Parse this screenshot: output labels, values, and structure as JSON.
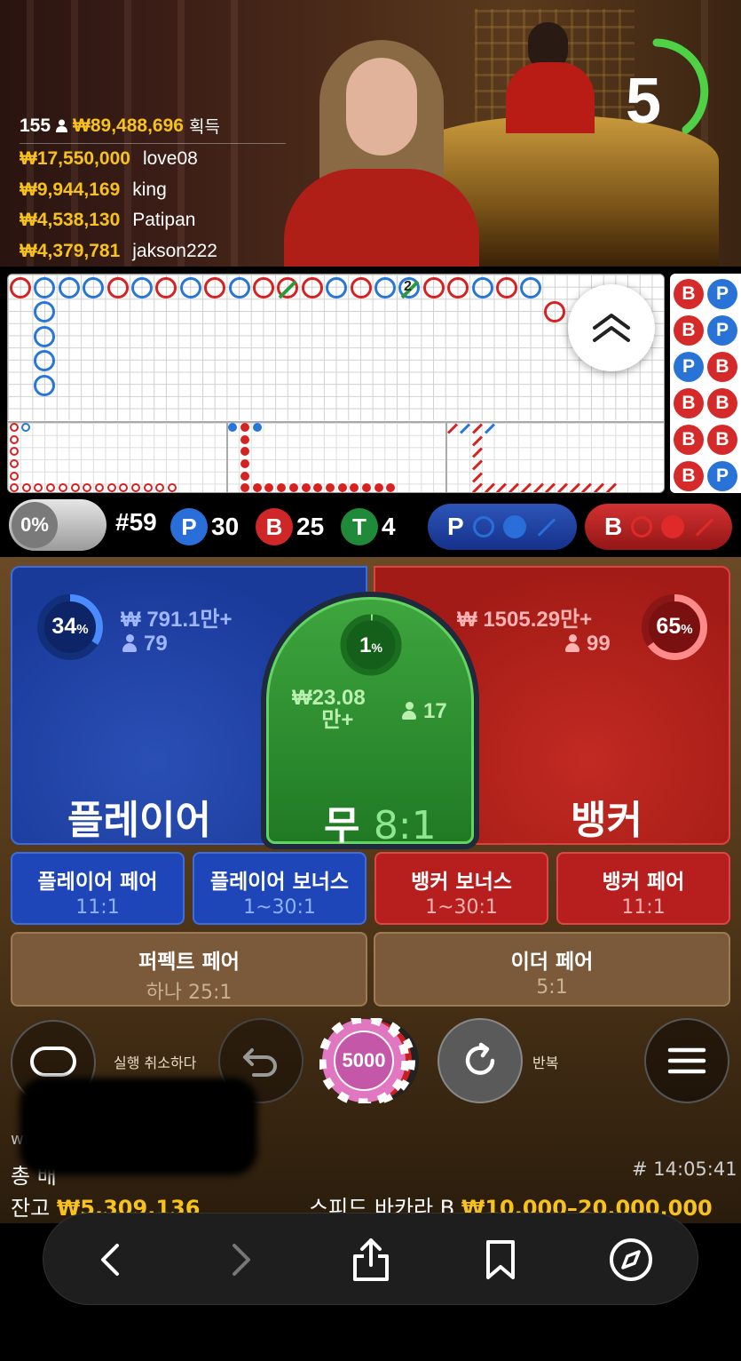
{
  "video": {
    "timer": "5",
    "winners_header": {
      "count": "155",
      "total": "₩89,488,696",
      "suffix": "획득"
    },
    "winners": [
      {
        "amount": "₩17,550,000",
        "name": "love08"
      },
      {
        "amount": "₩9,944,169",
        "name": "king"
      },
      {
        "amount": "₩4,538,130",
        "name": "Patipan"
      },
      {
        "amount": "₩4,379,781",
        "name": "jakson222"
      }
    ]
  },
  "roadmap": {
    "tie_marks": [
      "",
      "2"
    ]
  },
  "bead_column": [
    "B",
    "B",
    "P",
    "B",
    "B",
    "B",
    "P",
    "P",
    "B",
    "B",
    "B",
    "P"
  ],
  "stats": {
    "toggle_pct": "0%",
    "round": "#59",
    "player_label": "P",
    "player_count": "30",
    "banker_label": "B",
    "banker_count": "25",
    "tie_label": "T",
    "tie_count": "4",
    "predict_player": "P",
    "predict_banker": "B"
  },
  "bets": {
    "player": {
      "title": "플레이어",
      "pct": "34",
      "pct_sign": "%",
      "amount": "₩ 791.1만+",
      "users": "79"
    },
    "banker": {
      "title": "뱅커",
      "pct": "65",
      "pct_sign": "%",
      "amount": "₩ 1505.29만+",
      "users": "99"
    },
    "tie": {
      "title": "무",
      "odds": "8:1",
      "pct": "1",
      "pct_sign": "%",
      "amount_line1": "₩23.08",
      "amount_line2": "만+",
      "users": "17"
    },
    "side": [
      {
        "label": "플레이어 페어",
        "odds": "11:1"
      },
      {
        "label": "플레이어 보너스",
        "odds": "1~30:1"
      },
      {
        "label": "뱅커 보너스",
        "odds": "1~30:1"
      },
      {
        "label": "뱅커 페어",
        "odds": "11:1"
      }
    ],
    "perfect_pair": {
      "label": "퍼펙트 페어",
      "odds": "하나 25:1"
    },
    "either_pair": {
      "label": "이더 페어",
      "odds": "5:1"
    }
  },
  "controls": {
    "undo_label": "실행 취소하다",
    "chip_value": "5000",
    "repeat_label": "반복"
  },
  "info": {
    "partial_label": "wi",
    "total_bet_label": "총 배",
    "game_id": "# 14:05:41",
    "balance_label": "잔고",
    "balance_value": "₩5.309.136",
    "table_name": "스피드 바카라 B",
    "limits": "₩10.000–20.000,000"
  },
  "colors": {
    "player": "#2a6ed9",
    "banker": "#cf2727",
    "tie": "#1e8a3a",
    "gold": "#f6c21b"
  },
  "icons": [
    "chat-icon",
    "undo-icon",
    "repeat-icon",
    "menu-icon",
    "back-icon",
    "forward-icon",
    "share-icon",
    "bookmark-icon",
    "compass-icon",
    "chevrons-up-icon"
  ]
}
